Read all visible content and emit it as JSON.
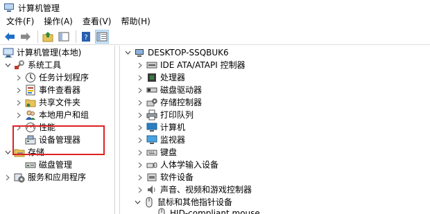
{
  "window": {
    "title": "计算机管理"
  },
  "menu": [
    "文件(F)",
    "操作(A)",
    "查看(V)",
    "帮助(H)"
  ],
  "toolbar": {
    "buttons": [
      "back-icon",
      "forward-icon",
      "up-folder-icon",
      "show-hide-tree-icon",
      "help-icon",
      "properties-icon"
    ]
  },
  "left_tree": [
    {
      "label": "计算机管理(本地)",
      "icon": "computer-management-icon"
    },
    {
      "label": "系统工具",
      "icon": "system-tools-icon"
    },
    {
      "label": "任务计划程序",
      "icon": "task-scheduler-icon"
    },
    {
      "label": "事件查看器",
      "icon": "event-viewer-icon"
    },
    {
      "label": "共享文件夹",
      "icon": "shared-folder-icon"
    },
    {
      "label": "本地用户和组",
      "icon": "users-icon"
    },
    {
      "label": "性能",
      "icon": "performance-icon"
    },
    {
      "label": "设备管理器",
      "icon": "device-manager-icon"
    },
    {
      "label": "存储",
      "icon": "storage-icon"
    },
    {
      "label": "磁盘管理",
      "icon": "disk-management-icon"
    },
    {
      "label": "服务和应用程序",
      "icon": "services-icon"
    }
  ],
  "right_tree": {
    "root": "DESKTOP-SSQBUK6",
    "items": [
      {
        "label": "IDE ATA/ATAPI 控制器",
        "icon": "ide-controller-icon"
      },
      {
        "label": "处理器",
        "icon": "processor-icon"
      },
      {
        "label": "磁盘驱动器",
        "icon": "disk-drive-icon"
      },
      {
        "label": "存储控制器",
        "icon": "storage-controller-icon"
      },
      {
        "label": "打印队列",
        "icon": "printer-icon"
      },
      {
        "label": "计算机",
        "icon": "computer-icon"
      },
      {
        "label": "监视器",
        "icon": "monitor-icon"
      },
      {
        "label": "键盘",
        "icon": "keyboard-icon"
      },
      {
        "label": "人体学输入设备",
        "icon": "hid-icon"
      },
      {
        "label": "软件设备",
        "icon": "software-device-icon"
      },
      {
        "label": "声音、视频和游戏控制器",
        "icon": "sound-icon"
      },
      {
        "label": "鼠标和其他指针设备",
        "icon": "mouse-icon"
      },
      {
        "label": "HID-compliant mouse",
        "icon": "mouse-icon"
      }
    ]
  }
}
